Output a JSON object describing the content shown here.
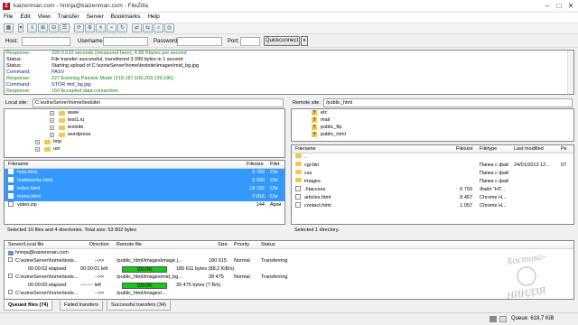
{
  "window": {
    "title": "kaizenman.com - hninja@kaizenman.com - FileZilla",
    "app_icon": "Z"
  },
  "menu": [
    "File",
    "Edit",
    "View",
    "Transfer",
    "Server",
    "Bookmarks",
    "Help"
  ],
  "quickconnect": {
    "host_label": "Host:",
    "username_label": "Username:",
    "password_label": "Password:",
    "port_label": "Port:",
    "button": "Quickconnect"
  },
  "log": [
    {
      "k": "Response:",
      "v": "226 0.610 seconds (measured here), 4.96 Kbytes per second",
      "type": "resp"
    },
    {
      "k": "Status:",
      "v": "File transfer successful, transferred 3 099 bytes in 1 second",
      "type": "status"
    },
    {
      "k": "Status:",
      "v": "Starting upload of C:\\ezineServer\\home\\testsite\\images\\mid_bg.jpg",
      "type": "status"
    },
    {
      "k": "Command:",
      "v": "PASV",
      "type": "cmd"
    },
    {
      "k": "Response:",
      "v": "227 Entering Passive Mode (216,187,109,203,139,180)",
      "type": "resp"
    },
    {
      "k": "Command:",
      "v": "STOR mid_bg.jpg",
      "type": "cmd"
    },
    {
      "k": "Response:",
      "v": "150 Accepted data connection",
      "type": "resp"
    }
  ],
  "local": {
    "label": "Local site:",
    "path": "C:\\ezineServer\\home\\testsite\\",
    "tree": [
      "www",
      "test1.ru",
      "testsite",
      "wordpress",
      "tmp",
      "usr"
    ],
    "columns": {
      "name": "Filename",
      "size": "Filesize",
      "type": "Filet"
    },
    "files": [
      {
        "name": "help.html",
        "size": "6 780",
        "type": "Chr",
        "selected": true
      },
      {
        "name": "howitworks.html",
        "size": "5 930",
        "type": "Chr",
        "selected": true
      },
      {
        "name": "index.html",
        "size": "18 192",
        "type": "Chr",
        "selected": true
      },
      {
        "name": "terms.html",
        "size": "2 816",
        "type": "Chr",
        "selected": true
      },
      {
        "name": "video.zip",
        "size": "144",
        "type": "Архи",
        "selected": false
      }
    ],
    "status": "Selected 10 files and 4 directories. Total size: 53 802 bytes"
  },
  "remote": {
    "label": "Remote site:",
    "path": "/public_html",
    "tree": [
      "etc",
      "mail",
      "public_ftp",
      "public_html"
    ],
    "columns": {
      "name": "Filename",
      "size": "Filesize",
      "type": "Filetype",
      "modified": "Last modified",
      "perm": "Pe"
    },
    "files": [
      {
        "name": "..",
        "size": "",
        "type": "",
        "modified": "",
        "perm": "",
        "kind": "up"
      },
      {
        "name": "cgi-bin",
        "size": "",
        "type": "Папка с фай",
        "modified": "24/01/2013 12...",
        "perm": "07",
        "kind": "dir"
      },
      {
        "name": "css",
        "size": "",
        "type": "Папка с фай",
        "modified": "",
        "perm": "",
        "kind": "dir"
      },
      {
        "name": "images",
        "size": "",
        "type": "Папка с фай",
        "modified": "",
        "perm": "",
        "kind": "dir"
      },
      {
        "name": ".htaccess",
        "size": "6 793",
        "type": "Файл \"HT...",
        "modified": "",
        "perm": "",
        "kind": "file"
      },
      {
        "name": "articles.html",
        "size": "8 457",
        "type": "Chrome H...",
        "modified": "",
        "perm": "",
        "kind": "file"
      },
      {
        "name": "contact.html",
        "size": "1 057",
        "type": "Chrome H...",
        "modified": "",
        "perm": "",
        "kind": "file"
      }
    ],
    "status": "Selected 1 directory."
  },
  "queue": {
    "columns": {
      "local": "Server/Local file",
      "dir": "Direction",
      "remote": "Remote file",
      "size": "Size",
      "prio": "Priority",
      "status": "Status"
    },
    "server": "hninja@kaizenman.com",
    "rows": [
      {
        "local": "C:\\ezineServer\\home\\tests...",
        "dir": "-->>",
        "remote": "/public_html/images/image.j...",
        "size": "180 615",
        "prio": "Normal",
        "status": "Transferring"
      },
      {
        "elapsed": "00:00:02 elapsed",
        "left": "00:00:01 left",
        "progress": 100,
        "bar_text": "100.0%",
        "info": "180 611 bytes (88,2 KiB/s)"
      },
      {
        "local": "C:\\ezineServer\\home\\tests...",
        "dir": "-->>",
        "remote": "/public_html/images/mid_bg...",
        "size": "39 475",
        "prio": "Normal",
        "status": "Transferring"
      },
      {
        "elapsed": "00:00:00 elapsed",
        "left": "--:--:-- left",
        "progress": 100,
        "bar_text": "100.0%",
        "info": "39 475 bytes (? B/s)"
      },
      {
        "local": "C:\\ezineServer\\home\\tests...",
        "dir": "-->>",
        "remote": "/public_html/images/...",
        "size": "",
        "prio": "",
        "status": ""
      }
    ]
  },
  "tabs": [
    {
      "label": "Queued files (74)",
      "active": true
    },
    {
      "label": "Failed transfers",
      "active": false
    },
    {
      "label": "Successful transfers (34)",
      "active": false
    }
  ],
  "statusbar": {
    "queue": "Queue: 618,7 KiB"
  },
  "watermark": {
    "line1": "Хостинг-",
    "line2": "НИНДЗЯ"
  }
}
